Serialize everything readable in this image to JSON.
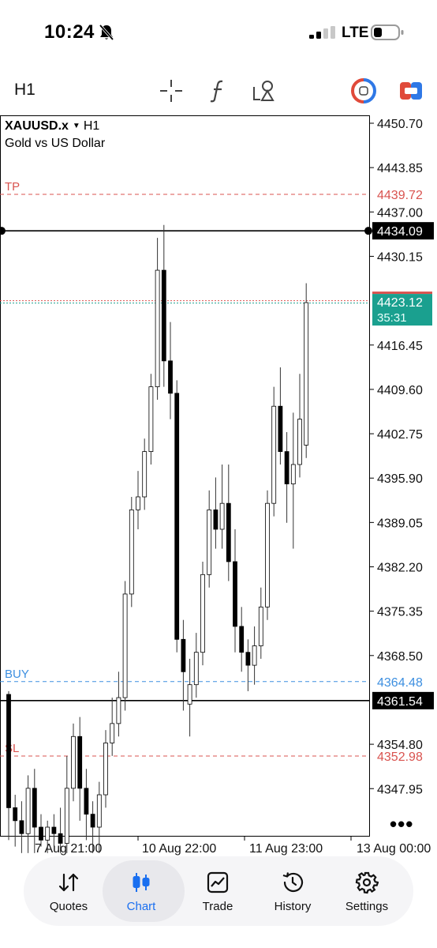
{
  "status_bar": {
    "time": "10:24",
    "network": "LTE",
    "icons": [
      "bell-slash-icon",
      "signal-icon",
      "battery-icon"
    ]
  },
  "toolbar": {
    "timeframe": "H1",
    "icons": [
      "crosshair-icon",
      "function-icon",
      "objects-icon",
      "one-click-trading-icon",
      "trade-panel-icon"
    ]
  },
  "chart": {
    "symbol": "XAUUSD.x",
    "timeframe": "H1",
    "description": "Gold vs US Dollar",
    "price_axis": [
      "4450.70",
      "4443.85",
      "4437.00",
      "4430.15",
      "4416.45",
      "4409.60",
      "4402.75",
      "4395.90",
      "4389.05",
      "4382.20",
      "4375.35",
      "4368.50",
      "4354.80",
      "4347.95"
    ],
    "time_axis": [
      "7 Aug 21:00",
      "10 Aug 22:00",
      "11 Aug 23:00",
      "13 Aug 00:00"
    ],
    "levels": {
      "tp": {
        "label": "TP",
        "price": "4439.72",
        "color": "#d9534f"
      },
      "buy": {
        "label": "BUY",
        "price": "4364.48",
        "color": "#3d8fe0"
      },
      "sl": {
        "label": "SL",
        "price": "4352.98",
        "color": "#d9534f"
      },
      "hline1": {
        "price": "4434.09"
      },
      "hline2": {
        "price": "4361.54"
      },
      "bid": {
        "price": "4423.12",
        "countdown": "35:31",
        "color": "#1aa08f"
      }
    },
    "more_label": "•••"
  },
  "chart_data": {
    "type": "candlestick",
    "candles": [
      [
        4362.5,
        4363.0,
        4340.0,
        4345.0
      ],
      [
        4345.0,
        4347.0,
        4339.0,
        4343.0
      ],
      [
        4343.0,
        4346.0,
        4338.0,
        4341.0
      ],
      [
        4341.0,
        4350.0,
        4338.0,
        4348.0
      ],
      [
        4348.0,
        4351.0,
        4338.0,
        4342.0
      ],
      [
        4342.0,
        4344.0,
        4339.0,
        4340.0
      ],
      [
        4340.0,
        4343.0,
        4338.0,
        4342.0
      ],
      [
        4342.0,
        4344.0,
        4339.0,
        4341.0
      ],
      [
        4341.0,
        4345.0,
        4338.0,
        4339.5
      ],
      [
        4339.5,
        4353.0,
        4338.0,
        4348.0
      ],
      [
        4348.0,
        4358.0,
        4346.0,
        4356.0
      ],
      [
        4356.0,
        4359.0,
        4343.0,
        4348.0
      ],
      [
        4348.0,
        4351.0,
        4340.0,
        4344.0
      ],
      [
        4344.0,
        4346.0,
        4338.0,
        4342.0
      ],
      [
        4342.0,
        4349.0,
        4338.0,
        4347.0
      ],
      [
        4347.0,
        4357.0,
        4345.0,
        4355.0
      ],
      [
        4355.0,
        4362.0,
        4353.0,
        4358.0
      ],
      [
        4358.0,
        4366.0,
        4356.0,
        4362.0
      ],
      [
        4362.0,
        4380.0,
        4360.0,
        4378.0
      ],
      [
        4378.0,
        4393.0,
        4376.0,
        4391.0
      ],
      [
        4391.0,
        4397.0,
        4388.0,
        4393.0
      ],
      [
        4393.0,
        4402.0,
        4391.0,
        4400.0
      ],
      [
        4400.0,
        4412.0,
        4398.0,
        4410.0
      ],
      [
        4410.0,
        4433.0,
        4408.0,
        4428.0
      ],
      [
        4428.0,
        4435.0,
        4410.0,
        4414.0
      ],
      [
        4414.0,
        4420.0,
        4405.0,
        4409.0
      ],
      [
        4409.0,
        4411.0,
        4369.0,
        4371.0
      ],
      [
        4371.0,
        4374.0,
        4360.0,
        4366.0
      ],
      [
        4361.0,
        4368.0,
        4356.0,
        4364.0
      ],
      [
        4364.0,
        4372.0,
        4362.0,
        4369.0
      ],
      [
        4369.0,
        4383.0,
        4367.0,
        4381.0
      ],
      [
        4381.0,
        4394.0,
        4379.0,
        4391.0
      ],
      [
        4391.0,
        4396.0,
        4385.0,
        4388.0
      ],
      [
        4388.0,
        4398.0,
        4385.0,
        4392.0
      ],
      [
        4392.0,
        4398.0,
        4380.0,
        4383.0
      ],
      [
        4383.0,
        4388.0,
        4369.0,
        4373.0
      ],
      [
        4373.0,
        4376.0,
        4366.0,
        4369.0
      ],
      [
        4369.0,
        4371.0,
        4363.0,
        4367.0
      ],
      [
        4367.0,
        4373.0,
        4364.0,
        4370.0
      ],
      [
        4370.0,
        4379.0,
        4368.0,
        4376.0
      ],
      [
        4376.0,
        4394.0,
        4374.0,
        4392.0
      ],
      [
        4392.0,
        4410.0,
        4390.0,
        4407.0
      ],
      [
        4407.0,
        4413.0,
        4398.0,
        4400.0
      ],
      [
        4400.0,
        4403.0,
        4389.0,
        4395.0
      ],
      [
        4395.0,
        4406.0,
        4385.0,
        4398.0
      ],
      [
        4398.0,
        4412.0,
        4396.0,
        4405.0
      ],
      [
        4401.0,
        4426.0,
        4399.0,
        4423.0
      ]
    ]
  },
  "nav": {
    "items": [
      {
        "label": "Quotes",
        "icon": "arrows-up-down-icon"
      },
      {
        "label": "Chart",
        "icon": "candlestick-icon"
      },
      {
        "label": "Trade",
        "icon": "trend-chart-icon"
      },
      {
        "label": "History",
        "icon": "history-clock-icon"
      },
      {
        "label": "Settings",
        "icon": "gear-icon"
      }
    ],
    "active": "Chart",
    "active_color": "#1a6ff0"
  }
}
